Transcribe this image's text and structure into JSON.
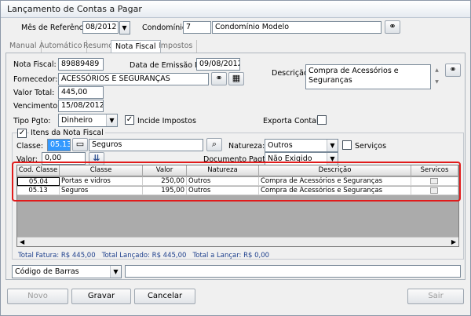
{
  "window": {
    "title": "Lançamento de Contas a Pagar"
  },
  "header": {
    "mes_label": "Mês de Referência:",
    "mes_value": "08/2012",
    "condominio_label": "Condomínio:",
    "condominio_code": "7",
    "condominio_name": "Condomínio Modelo"
  },
  "tabs": [
    {
      "label": "Manual"
    },
    {
      "label": "Automático"
    },
    {
      "label": "Resumo"
    },
    {
      "label": "Nota Fiscal"
    },
    {
      "label": "Impostos"
    }
  ],
  "form": {
    "nota_label": "Nota Fiscal:",
    "nota_value": "89889489",
    "emissao_label": "Data de Emissão NF:",
    "emissao_value": "09/08/2012",
    "fornecedor_label": "Fornecedor:",
    "fornecedor_value": "ACESSÓRIOS E SEGURANÇAS",
    "descricao_label": "Descrição:",
    "descricao_value": "Compra de Acessórios e Seguranças",
    "valor_total_label": "Valor Total:",
    "valor_total_value": "445,00",
    "vencimento_label": "Vencimento:",
    "vencimento_value": "15/08/2012",
    "tipo_label": "Tipo Pgto:",
    "tipo_value": "Dinheiro",
    "incide_label": "Incide Impostos",
    "exporta_label": "Exporta Contabil"
  },
  "itens": {
    "group_label": "Itens da Nota Fiscal",
    "classe_label": "Classe:",
    "classe_code": "05.13",
    "classe_name": "Seguros",
    "natureza_label": "Natureza:",
    "natureza_value": "Outros",
    "servicos_label": "Serviços",
    "valor_label": "Valor:",
    "valor_value": "0,00",
    "doc_label": "Documento Pagto:",
    "doc_value": "Não Exigido"
  },
  "table": {
    "headers": [
      "Cod. Classe",
      "Classe",
      "Valor",
      "Natureza",
      "Descrição",
      "Servicos"
    ],
    "rows": [
      {
        "cod": "05.04",
        "classe": "Portas e vidros",
        "valor": "250,00",
        "natureza": "Outros",
        "descricao": "Compra de Acessórios e Seguranças"
      },
      {
        "cod": "05.13",
        "classe": "Seguros",
        "valor": "195,00",
        "natureza": "Outros",
        "descricao": "Compra de Acessórios e Seguranças"
      }
    ]
  },
  "totals": {
    "fatura": "Total Fatura: R$ 445,00",
    "lancado": "Total Lançado: R$ 445,00",
    "a_lancar": "Total a Lançar: R$ 0,00"
  },
  "barcode": {
    "type": "Código de Barras",
    "value": ""
  },
  "buttons": {
    "novo": "Novo",
    "gravar": "Gravar",
    "cancelar": "Cancelar",
    "sair": "Sair"
  }
}
